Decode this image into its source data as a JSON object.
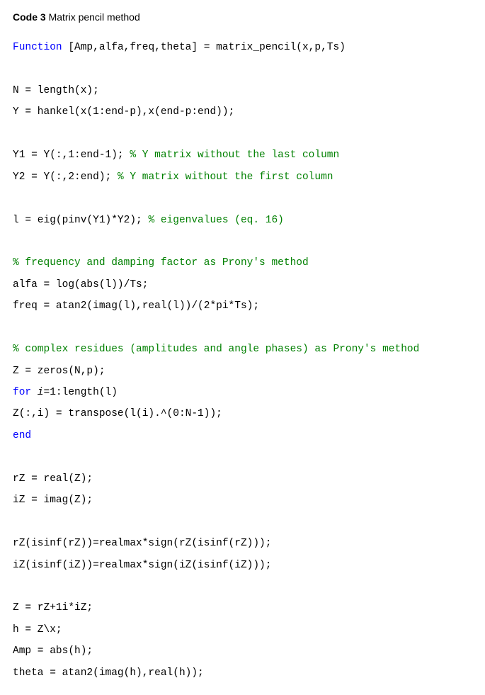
{
  "title_prefix": "Code 3",
  "title_text": " Matrix pencil method",
  "code": {
    "line1_kw": "Function",
    "line1_rest": " [Amp,alfa,freq,theta] = matrix_pencil(x,p,Ts)",
    "line3": "N = length(x);",
    "line4": "Y = hankel(x(1:end-p),x(end-p:end));",
    "line6a": "Y1 = Y(:,1:end-1); ",
    "line6b": "% Y matrix without the last column",
    "line7a": "Y2 = Y(:,2:end); ",
    "line7b": "% Y matrix without the first column",
    "line9a": "l = eig(pinv(Y1)*Y2); ",
    "line9b": "% eigenvalues (eq. 16)",
    "line11cm": "% frequency and damping factor as Prony's method",
    "line12": "alfa = log(abs(l))/Ts;",
    "line13": "freq = atan2(imag(l),real(l))/(2*pi*Ts);",
    "line15cm": "% complex residues (amplitudes and angle phases) as Prony's method",
    "line16": "Z = zeros(N,p);",
    "line17a": "for",
    "line17b": " i",
    "line17c": "=1:length(l)",
    "line18": "Z(:,i) = transpose(l(i).^(0:N-1));",
    "line19": "end",
    "line21": "rZ = real(Z);",
    "line22": "iZ = imag(Z);",
    "line24": "rZ(isinf(rZ))=realmax*sign(rZ(isinf(rZ)));",
    "line25": "iZ(isinf(iZ))=realmax*sign(iZ(isinf(iZ)));",
    "line27": "Z = rZ+1i*iZ;",
    "line28": "h = Z\\x;",
    "line29": "Amp = abs(h);",
    "line30": "theta = atan2(imag(h),real(h));"
  }
}
